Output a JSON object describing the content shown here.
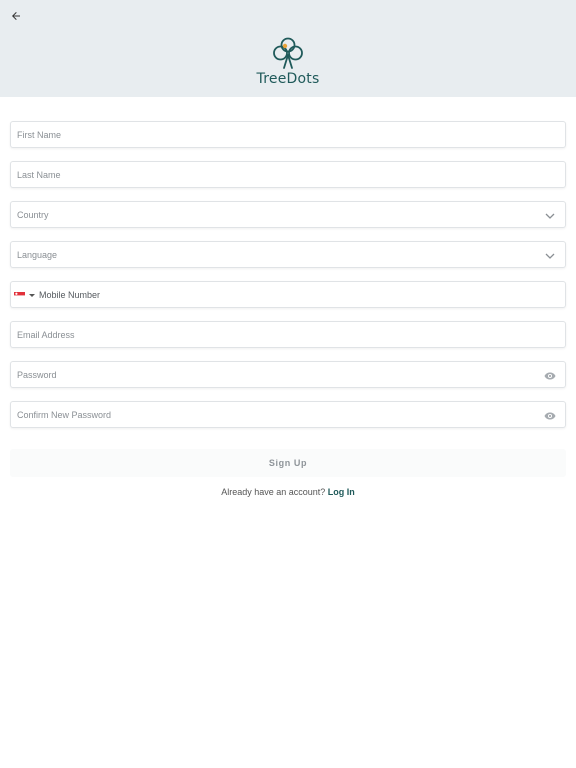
{
  "header": {
    "back_icon": "arrow-left-icon",
    "logo_text": "TreeDots",
    "logo_icon": "treedots-logo-icon",
    "colors": {
      "background": "#e8edf0",
      "brand": "#1f5a5a",
      "brand_accent": "#e8a33a"
    }
  },
  "form": {
    "first_name": {
      "placeholder": "First Name",
      "value": ""
    },
    "last_name": {
      "placeholder": "Last Name",
      "value": ""
    },
    "country": {
      "label": "Country",
      "icon": "chevron-down-icon"
    },
    "language": {
      "label": "Language",
      "icon": "chevron-down-icon"
    },
    "mobile": {
      "placeholder": "Mobile Number",
      "value": "",
      "flag_icon": "singapore-flag-icon"
    },
    "email": {
      "placeholder": "Email Address",
      "value": ""
    },
    "password": {
      "placeholder": "Password",
      "value": "",
      "icon": "eye-icon"
    },
    "confirm_password": {
      "placeholder": "Confirm New Password",
      "value": "",
      "icon": "eye-icon"
    }
  },
  "actions": {
    "signup_label": "Sign Up",
    "login_prompt": "Already have an account?",
    "login_link": "Log In"
  }
}
